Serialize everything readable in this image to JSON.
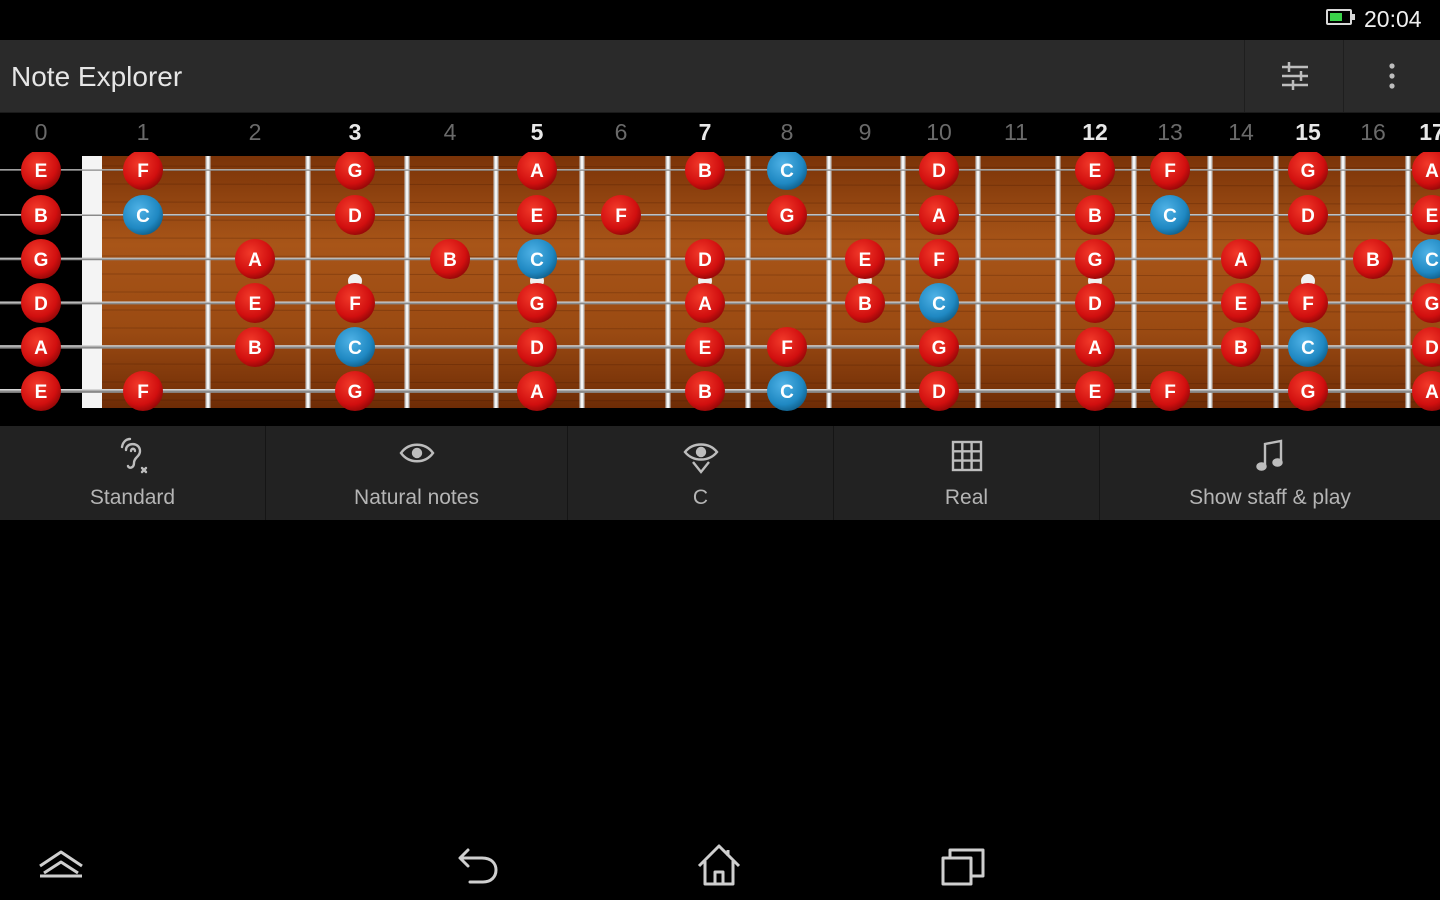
{
  "status_bar": {
    "time": "20:04",
    "battery_icon": "battery-icon"
  },
  "app_bar": {
    "title": "Note Explorer",
    "actions": [
      {
        "icon": "sliders-icon"
      },
      {
        "icon": "more-vert-icon"
      }
    ]
  },
  "colors": {
    "natural_note": "#d10f0f",
    "highlight_note": "#1f88c2",
    "fretboard_wood": "#9c4a12",
    "toolbar_bg": "#222222",
    "actionbar_bg": "#2a2a2a"
  },
  "fretboard": {
    "fret_numbers": [
      "0",
      "1",
      "2",
      "3",
      "4",
      "5",
      "6",
      "7",
      "8",
      "9",
      "10",
      "11",
      "12",
      "13",
      "14",
      "15",
      "16",
      "17"
    ],
    "marked_frets": [
      3,
      5,
      7,
      12,
      15,
      17
    ],
    "inlay_frets": [
      3,
      5,
      7,
      9,
      12,
      15
    ],
    "open_strings": [
      "E",
      "B",
      "G",
      "D",
      "A",
      "E"
    ],
    "highlight_note": "C",
    "notes": [
      {
        "string": 1,
        "fret": 1,
        "note": "F"
      },
      {
        "string": 1,
        "fret": 3,
        "note": "G"
      },
      {
        "string": 1,
        "fret": 5,
        "note": "A"
      },
      {
        "string": 1,
        "fret": 7,
        "note": "B"
      },
      {
        "string": 1,
        "fret": 8,
        "note": "C"
      },
      {
        "string": 1,
        "fret": 10,
        "note": "D"
      },
      {
        "string": 1,
        "fret": 12,
        "note": "E"
      },
      {
        "string": 1,
        "fret": 13,
        "note": "F"
      },
      {
        "string": 1,
        "fret": 15,
        "note": "G"
      },
      {
        "string": 1,
        "fret": 17,
        "note": "A"
      },
      {
        "string": 2,
        "fret": 1,
        "note": "C"
      },
      {
        "string": 2,
        "fret": 3,
        "note": "D"
      },
      {
        "string": 2,
        "fret": 5,
        "note": "E"
      },
      {
        "string": 2,
        "fret": 6,
        "note": "F"
      },
      {
        "string": 2,
        "fret": 8,
        "note": "G"
      },
      {
        "string": 2,
        "fret": 10,
        "note": "A"
      },
      {
        "string": 2,
        "fret": 12,
        "note": "B"
      },
      {
        "string": 2,
        "fret": 13,
        "note": "C"
      },
      {
        "string": 2,
        "fret": 15,
        "note": "D"
      },
      {
        "string": 2,
        "fret": 17,
        "note": "E"
      },
      {
        "string": 3,
        "fret": 2,
        "note": "A"
      },
      {
        "string": 3,
        "fret": 4,
        "note": "B"
      },
      {
        "string": 3,
        "fret": 5,
        "note": "C"
      },
      {
        "string": 3,
        "fret": 7,
        "note": "D"
      },
      {
        "string": 3,
        "fret": 9,
        "note": "E"
      },
      {
        "string": 3,
        "fret": 10,
        "note": "F"
      },
      {
        "string": 3,
        "fret": 12,
        "note": "G"
      },
      {
        "string": 3,
        "fret": 14,
        "note": "A"
      },
      {
        "string": 3,
        "fret": 16,
        "note": "B"
      },
      {
        "string": 3,
        "fret": 17,
        "note": "C"
      },
      {
        "string": 4,
        "fret": 2,
        "note": "E"
      },
      {
        "string": 4,
        "fret": 3,
        "note": "F"
      },
      {
        "string": 4,
        "fret": 5,
        "note": "G"
      },
      {
        "string": 4,
        "fret": 7,
        "note": "A"
      },
      {
        "string": 4,
        "fret": 9,
        "note": "B"
      },
      {
        "string": 4,
        "fret": 10,
        "note": "C"
      },
      {
        "string": 4,
        "fret": 12,
        "note": "D"
      },
      {
        "string": 4,
        "fret": 14,
        "note": "E"
      },
      {
        "string": 4,
        "fret": 15,
        "note": "F"
      },
      {
        "string": 4,
        "fret": 17,
        "note": "G"
      },
      {
        "string": 5,
        "fret": 2,
        "note": "B"
      },
      {
        "string": 5,
        "fret": 3,
        "note": "C"
      },
      {
        "string": 5,
        "fret": 5,
        "note": "D"
      },
      {
        "string": 5,
        "fret": 7,
        "note": "E"
      },
      {
        "string": 5,
        "fret": 8,
        "note": "F"
      },
      {
        "string": 5,
        "fret": 10,
        "note": "G"
      },
      {
        "string": 5,
        "fret": 12,
        "note": "A"
      },
      {
        "string": 5,
        "fret": 14,
        "note": "B"
      },
      {
        "string": 5,
        "fret": 15,
        "note": "C"
      },
      {
        "string": 5,
        "fret": 17,
        "note": "D"
      },
      {
        "string": 6,
        "fret": 1,
        "note": "F"
      },
      {
        "string": 6,
        "fret": 3,
        "note": "G"
      },
      {
        "string": 6,
        "fret": 5,
        "note": "A"
      },
      {
        "string": 6,
        "fret": 7,
        "note": "B"
      },
      {
        "string": 6,
        "fret": 8,
        "note": "C"
      },
      {
        "string": 6,
        "fret": 10,
        "note": "D"
      },
      {
        "string": 6,
        "fret": 12,
        "note": "E"
      },
      {
        "string": 6,
        "fret": 13,
        "note": "F"
      },
      {
        "string": 6,
        "fret": 15,
        "note": "G"
      },
      {
        "string": 6,
        "fret": 17,
        "note": "A"
      }
    ]
  },
  "toolbar": {
    "items": [
      {
        "label": "Standard",
        "icon": "tuning-icon"
      },
      {
        "label": "Natural notes",
        "icon": "eye-icon"
      },
      {
        "label": "C",
        "icon": "eye-focus-icon"
      },
      {
        "label": "Real",
        "icon": "grid-icon"
      },
      {
        "label": "Show staff & play",
        "icon": "music-note-icon"
      }
    ]
  },
  "nav_bar": {
    "buttons": [
      {
        "icon": "expand-up-icon"
      },
      {
        "icon": "back-icon"
      },
      {
        "icon": "home-icon"
      },
      {
        "icon": "recent-apps-icon"
      }
    ]
  }
}
